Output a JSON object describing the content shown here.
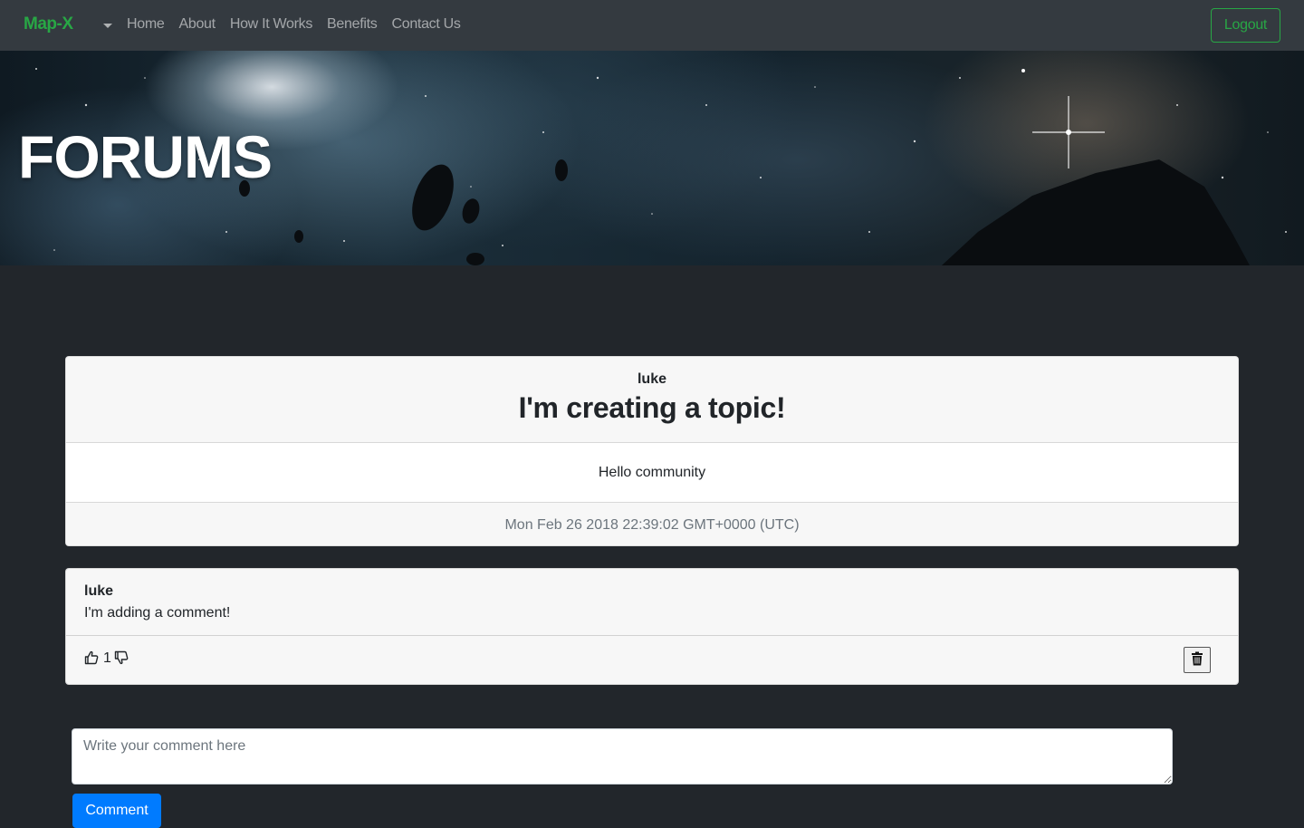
{
  "navbar": {
    "brand": "Map-X",
    "links": [
      "Home",
      "About",
      "How It Works",
      "Benefits",
      "Contact Us"
    ],
    "logout_label": "Logout"
  },
  "hero": {
    "title": "FORUMS"
  },
  "topic": {
    "author": "luke",
    "title": "I'm creating a topic!",
    "body": "Hello community",
    "timestamp": "Mon Feb 26 2018 22:39:02 GMT+0000 (UTC)"
  },
  "comments": [
    {
      "author": "luke",
      "text": "I'm adding a comment!",
      "votes": "1"
    }
  ],
  "comment_form": {
    "placeholder": "Write your comment here",
    "submit_label": "Comment"
  },
  "colors": {
    "brand": "#28a745",
    "navbar_bg": "#343a40",
    "page_bg": "#22262b",
    "primary": "#007bff"
  }
}
